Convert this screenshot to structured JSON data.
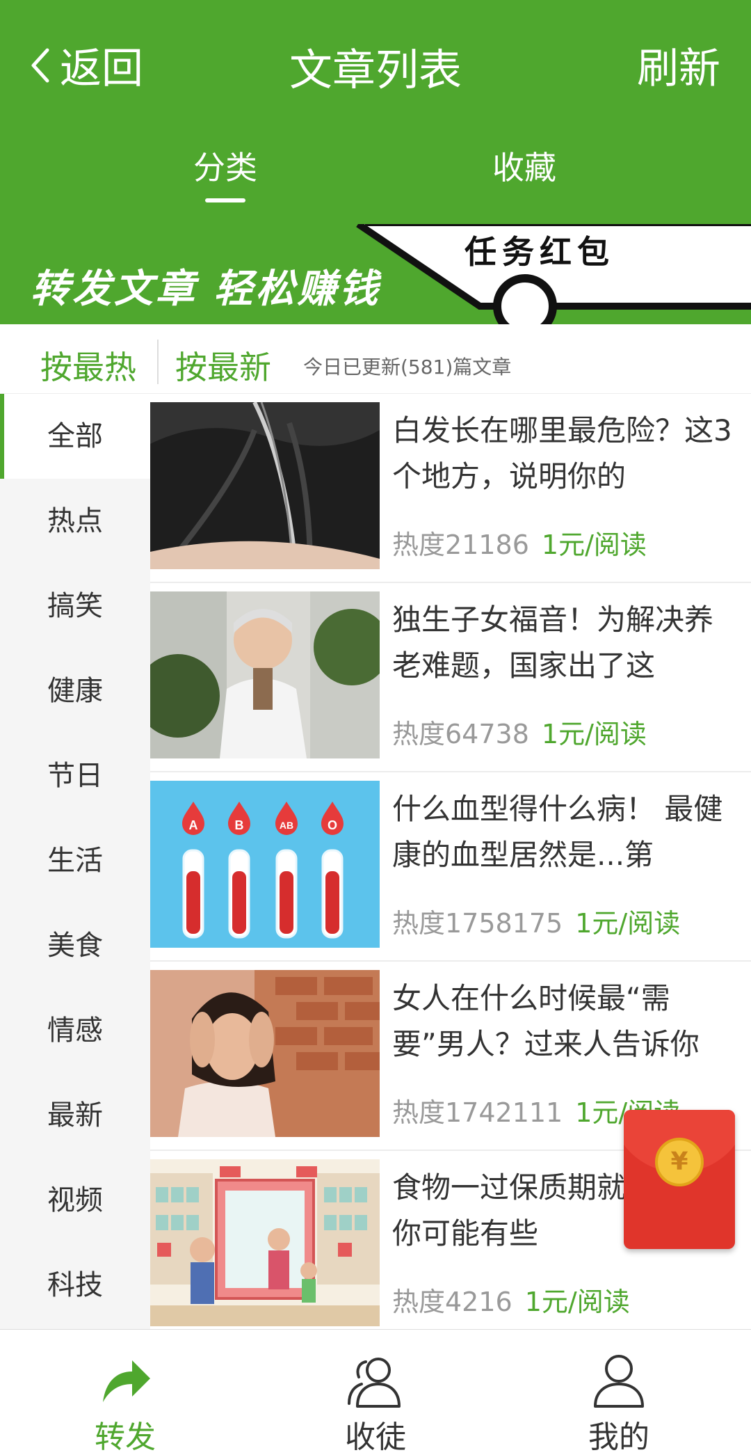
{
  "header": {
    "back_label": "返回",
    "title": "文章列表",
    "refresh_label": "刷新",
    "tabs": [
      {
        "label": "分类",
        "active": true
      },
      {
        "label": "收藏",
        "active": false
      }
    ]
  },
  "banner": {
    "slogan": "转发文章  轻松赚钱",
    "badge": "任务红包"
  },
  "sort": {
    "hot_label": "按最热",
    "new_label": "按最新",
    "info": "今日已更新(581)篇文章"
  },
  "categories": [
    {
      "label": "全部",
      "active": true
    },
    {
      "label": "热点"
    },
    {
      "label": "搞笑"
    },
    {
      "label": "健康"
    },
    {
      "label": "节日"
    },
    {
      "label": "生活"
    },
    {
      "label": "美食"
    },
    {
      "label": "情感"
    },
    {
      "label": "最新"
    },
    {
      "label": "视频"
    },
    {
      "label": "科技"
    }
  ],
  "articles": [
    {
      "title": "白发长在哪里最危险？这3个地方，说明你的",
      "heat": "热度21186",
      "price": "1元/阅读"
    },
    {
      "title": "独生子女福音！为解决养老难题，国家出了这",
      "heat": "热度64738",
      "price": "1元/阅读"
    },
    {
      "title": "什么血型得什么病！ 最健康的血型居然是...第",
      "heat": "热度1758175",
      "price": "1元/阅读"
    },
    {
      "title": "女人在什么时候最“需要”男人？过来人告诉你",
      "heat": "热度1742111",
      "price": "1元/阅读"
    },
    {
      "title": "食物一过保质期就要扔？你可能有些",
      "heat": "热度4216",
      "price": "1元/阅读"
    }
  ],
  "thumb_labels": {
    "a": "A",
    "b": "B",
    "ab": "AB",
    "o": "O"
  },
  "redpacket": {
    "symbol": "¥"
  },
  "bottom_nav": [
    {
      "label": "转发",
      "icon": "share-arrow-icon",
      "active": true
    },
    {
      "label": "收徒",
      "icon": "users-icon",
      "active": false
    },
    {
      "label": "我的",
      "icon": "user-icon",
      "active": false
    }
  ],
  "colors": {
    "brand": "#4fa72e",
    "red": "#e0352b",
    "gold": "#f5c33b"
  }
}
